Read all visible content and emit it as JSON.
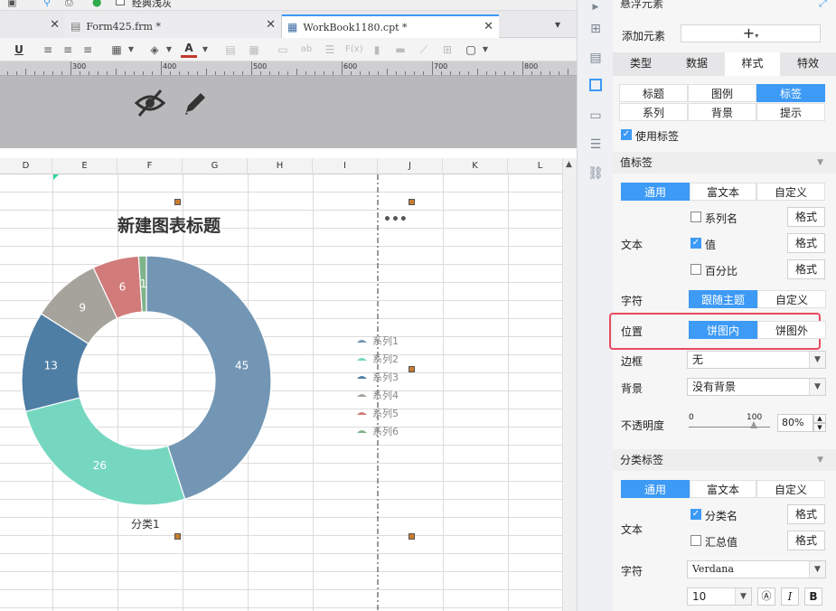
{
  "topbar": {
    "classic_view_label": "经典浅灰"
  },
  "tabs": [
    {
      "label": "Form425.frm *"
    },
    {
      "label": "WorkBook1180.cpt *"
    }
  ],
  "ruler": {
    "marks": [
      "300",
      "400",
      "500",
      "600",
      "700",
      "800"
    ]
  },
  "columns": [
    "D",
    "E",
    "F",
    "G",
    "H",
    "I",
    "J",
    "K",
    "L"
  ],
  "chart_data": {
    "type": "pie",
    "variant": "donut",
    "title": "新建图表标题",
    "category_label": "分类1",
    "series": [
      {
        "name": "系列1",
        "value": 45,
        "color": "#7296b4"
      },
      {
        "name": "系列2",
        "value": 26,
        "color": "#76d7c0"
      },
      {
        "name": "系列3",
        "value": 13,
        "color": "#4f7ea5"
      },
      {
        "name": "系列4",
        "value": 9,
        "color": "#a6a39c"
      },
      {
        "name": "系列5",
        "value": 6,
        "color": "#d17b7b"
      },
      {
        "name": "系列6",
        "value": 1,
        "color": "#7fb38a"
      }
    ],
    "legend_placement": "right"
  },
  "panel": {
    "header_title": "悬浮元素",
    "add_element_label": "添加元素",
    "main_tabs": [
      "类型",
      "数据",
      "样式",
      "特效"
    ],
    "main_tab_active": "样式",
    "sub_tabs_row1": [
      "标题",
      "图例",
      "标签"
    ],
    "sub_tabs_row2": [
      "系列",
      "背景",
      "提示"
    ],
    "sub_tab_active": "标签",
    "use_label": "使用标签",
    "value_label_section": "值标签",
    "mode_tabs": [
      "通用",
      "富文本",
      "自定义"
    ],
    "text_label": "文本",
    "value_options": [
      {
        "label": "系列名",
        "checked": false
      },
      {
        "label": "值",
        "checked": true
      },
      {
        "label": "百分比",
        "checked": false
      }
    ],
    "format_button": "格式",
    "char_label": "字符",
    "char_options": [
      "跟随主题",
      "自定义"
    ],
    "position_label": "位置",
    "position_options": [
      "饼图内",
      "饼图外"
    ],
    "border_label": "边框",
    "border_value": "无",
    "background_label": "背景",
    "background_value": "没有背景",
    "opacity_label": "不透明度",
    "opacity_min": "0",
    "opacity_max": "100",
    "opacity_value": "80%",
    "opacity_fraction": 0.8,
    "category_label_section": "分类标签",
    "category_options": [
      {
        "label": "分类名",
        "checked": true
      },
      {
        "label": "汇总值",
        "checked": false
      }
    ],
    "font_label": "字符",
    "font_value": "Verdana",
    "font_size": "10",
    "italic_btn": "I",
    "bold_btn": "B"
  },
  "colors": {
    "accent": "#3d9af5",
    "highlight_box": "#e84a5f"
  }
}
